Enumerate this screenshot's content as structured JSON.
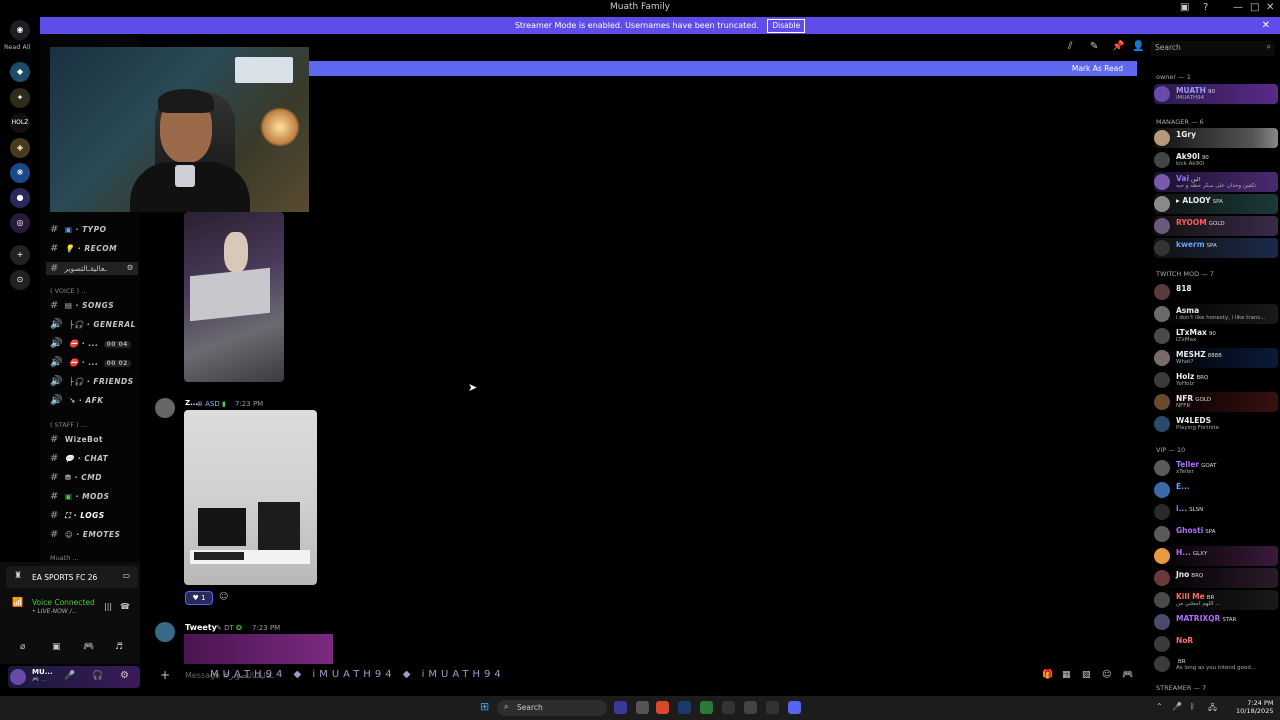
{
  "window": {
    "title": "Muath Family"
  },
  "banner": {
    "text": "Streamer Mode is enabled. Usernames have been truncated.",
    "disable_label": "Disable"
  },
  "guilds": {
    "read_all": "Read All",
    "holz_label": "HOLZ"
  },
  "header": {
    "server_name": "Muath Family",
    "search_placeholder": "Search",
    "mark_as_read": "Mark As Read"
  },
  "channels": [
    {
      "name": "TYPO",
      "kind": "text"
    },
    {
      "name": "RECOM",
      "kind": "text"
    },
    {
      "name": "ـعاليةـالتصوير",
      "kind": "text"
    },
    {
      "name": "( VOICE ) ...",
      "kind": "category"
    },
    {
      "name": "SONGS",
      "kind": "text"
    },
    {
      "name": "GENERAL",
      "kind": "voice"
    },
    {
      "name": "...",
      "kind": "voice",
      "count": "00 04"
    },
    {
      "name": "...",
      "kind": "voice",
      "count": "00 02"
    },
    {
      "name": "FRIENDS",
      "kind": "voice"
    },
    {
      "name": "AFK",
      "kind": "voice"
    },
    {
      "name": "( STAFF ) ...",
      "kind": "category"
    },
    {
      "name": "WizeBot",
      "kind": "text"
    },
    {
      "name": "CHAT",
      "kind": "text"
    },
    {
      "name": "CMD",
      "kind": "text"
    },
    {
      "name": "MODS",
      "kind": "text"
    },
    {
      "name": "LOGS",
      "kind": "text"
    },
    {
      "name": "EMOTES",
      "kind": "text"
    },
    {
      "name": "Muath ...",
      "kind": "category"
    }
  ],
  "activity": {
    "game": "EA SPORTS FC 26"
  },
  "voice": {
    "status": "Voice Connected",
    "channel": "• LIVE-NOW /..."
  },
  "user": {
    "name": "MU...",
    "status": "🎮 ..."
  },
  "messages": [
    {
      "author": "Z...",
      "tag": "ASD",
      "time": "7:23 PM",
      "reaction_count": "1"
    },
    {
      "author": "Tweety",
      "tag": "DT",
      "time": "7:23 PM"
    }
  ],
  "composer": {
    "placeholder": "Message #ـعاليةـالتصوير",
    "overlay": "MUATH94 ◆ iMUATH94 ◆ iMUATH94"
  },
  "members": {
    "owner_header": "owner — 1",
    "owner": [
      {
        "name": "MUATH",
        "badge": "90",
        "status": "iMUATH94",
        "color": "#9b6cff"
      }
    ],
    "manager_header": "MANAGER — 6",
    "managers": [
      {
        "name": "1Gry",
        "color": "#e8e8e8",
        "status": ""
      },
      {
        "name": "Ak90l",
        "badge": "90",
        "status": "kick Ak90l",
        "color": "#e8e8e8"
      },
      {
        "name": "Vai",
        "badge": "الين",
        "status": "تكفين وحدان على سكر حطه و حبه",
        "color": "#a070ff"
      },
      {
        "name": "ALOOY",
        "badge": "SPA",
        "status": "",
        "color": "#e8e8e8"
      },
      {
        "name": "RYOOM",
        "badge": "GOLD",
        "status": "",
        "color": "#ff5a5a"
      },
      {
        "name": "kwerm",
        "badge": "SPA",
        "status": "",
        "color": "#6aa0ff"
      }
    ],
    "twitch_header": "TWITCH MOD — 7",
    "twitch": [
      {
        "name": "818",
        "status": "",
        "color": "#e8e8e8"
      },
      {
        "name": "Asma",
        "status": "i don't like honesty, i like trans...",
        "color": "#e8e8e8"
      },
      {
        "name": "LTxMax",
        "badge": "90",
        "status": "LTxMax",
        "color": "#e8e8e8"
      },
      {
        "name": "MESHZ",
        "badge": "8888",
        "status": "What?",
        "color": "#e8e8e8"
      },
      {
        "name": "Holz",
        "badge": "BRQ",
        "status": "YoHolz",
        "color": "#e8e8e8"
      },
      {
        "name": "NFR",
        "badge": "GOLD",
        "status": "NFFR",
        "color": "#e8e8e8"
      },
      {
        "name": "W4LEDS",
        "status": "Playing Fortnite",
        "color": "#e8e8e8"
      }
    ],
    "vip_header": "VIP — 10",
    "vip": [
      {
        "name": "Teller",
        "badge": "GOAT",
        "status": "xTeller",
        "color": "#b070ff"
      },
      {
        "name": "E...",
        "status": "",
        "color": "#6aa0ff"
      },
      {
        "name": "i...",
        "badge": "SLSN",
        "status": "",
        "color": "#b070ff"
      },
      {
        "name": "Ghosti",
        "badge": "SPA",
        "status": "",
        "color": "#b070ff"
      },
      {
        "name": "H...",
        "badge": "GLXY",
        "status": "",
        "color": "#b070ff"
      },
      {
        "name": "Jno",
        "badge": "BRQ",
        "status": "",
        "color": "#e8e8e8"
      },
      {
        "name": "Kill Me",
        "badge": "BR",
        "status": "اللهم اجعلني من ...",
        "color": "#ff6a6a"
      },
      {
        "name": "MATRIXQR",
        "badge": "STAR",
        "status": "",
        "color": "#b070ff"
      },
      {
        "name": "NoR",
        "status": "",
        "color": "#ff6a6a"
      },
      {
        "name": "",
        "badge": "BR",
        "status": "As long as you intend good...",
        "color": "#e8e8e8"
      }
    ],
    "streamer_header": "STREAMER — 7"
  },
  "taskbar": {
    "search": "Search",
    "time": "7:24 PM",
    "date": "10/18/2025"
  }
}
